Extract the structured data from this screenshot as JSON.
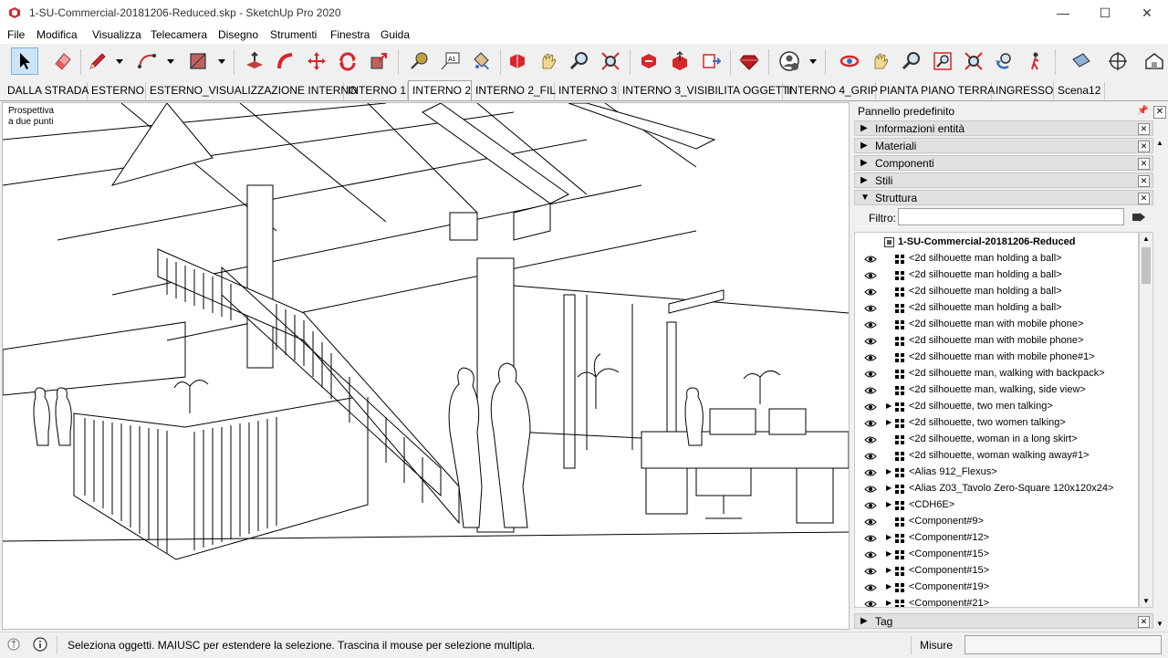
{
  "window": {
    "title": "1-SU-Commercial-20181206-Reduced.skp - SketchUp Pro 2020",
    "controls": [
      "—",
      "☐",
      "✕"
    ]
  },
  "menu": [
    "File",
    "Modifica",
    "Visualizza",
    "Telecamera",
    "Disegno",
    "Strumenti",
    "Finestra",
    "Guida"
  ],
  "toolbar": {
    "tools": [
      "select-tool",
      "eraser-tool",
      "line-tool",
      "arc-tool",
      "rectangle-tool",
      "push-pull-tool",
      "follow-me-tool",
      "move-tool",
      "rotate-tool",
      "scale-tool",
      "tape-measure-tool",
      "text-tool",
      "paint-bucket-tool",
      "components-tool",
      "warehouse-tool",
      "share-model-tool",
      "extension-warehouse-tool",
      "ruby-tool",
      "account-tool",
      "orbit-tool",
      "pan-tool",
      "zoom-tool",
      "zoom-window-tool",
      "zoom-extents-tool",
      "previous-view-tool",
      "walk-tool",
      "section-plane-tool",
      "position-camera-tool",
      "look-around-tool"
    ],
    "text_tool_label": "A1"
  },
  "scenes": {
    "tabs": [
      "DALLA STRADA",
      "ESTERNO",
      "ESTERNO_VISUALIZZAZIONE INTERNO",
      "INTERNO 1",
      "INTERNO 2",
      "INTERNO 2_FIL",
      "INTERNO 3",
      "INTERNO 3_VISIBILITA OGGETTI",
      "INTERNO 4_GRIP",
      "PIANTA PIANO TERRA",
      "INGRESSO",
      "Scena12"
    ],
    "active_index": 4
  },
  "viewport": {
    "perspective_label_line1": "Prospettiva",
    "perspective_label_line2": "a due punti"
  },
  "panel": {
    "title": "Pannello predefinito",
    "sections": [
      {
        "label": "Informazioni entità",
        "expanded": false
      },
      {
        "label": "Materiali",
        "expanded": false
      },
      {
        "label": "Componenti",
        "expanded": false
      },
      {
        "label": "Stili",
        "expanded": false
      },
      {
        "label": "Struttura",
        "expanded": true
      }
    ],
    "filter_label": "Filtro:",
    "filter_value": "",
    "outliner_root": "1-SU-Commercial-20181206-Reduced",
    "outliner_items": [
      {
        "label": "<2d silhouette man holding a ball>",
        "expandable": false
      },
      {
        "label": "<2d silhouette man holding a ball>",
        "expandable": false
      },
      {
        "label": "<2d silhouette man holding a ball>",
        "expandable": false
      },
      {
        "label": "<2d silhouette man holding a ball>",
        "expandable": false
      },
      {
        "label": "<2d silhouette man with mobile phone>",
        "expandable": false
      },
      {
        "label": "<2d silhouette man with mobile phone>",
        "expandable": false
      },
      {
        "label": "<2d silhouette man with mobile phone#1>",
        "expandable": false
      },
      {
        "label": "<2d silhouette man, walking with backpack>",
        "expandable": false
      },
      {
        "label": "<2d silhouette man, walking, side view>",
        "expandable": false
      },
      {
        "label": "<2d silhouette, two men talking>",
        "expandable": true
      },
      {
        "label": "<2d silhouette, two women talking>",
        "expandable": true
      },
      {
        "label": "<2d silhouette, woman in a long skirt>",
        "expandable": false
      },
      {
        "label": "<2d silhouette, woman walking away#1>",
        "expandable": false
      },
      {
        "label": "<Alias 912_Flexus>",
        "expandable": true
      },
      {
        "label": "<Alias Z03_Tavolo Zero-Square 120x120x24>",
        "expandable": true
      },
      {
        "label": "<CDH6E>",
        "expandable": true
      },
      {
        "label": "<Component#9>",
        "expandable": false
      },
      {
        "label": "<Component#12>",
        "expandable": true
      },
      {
        "label": "<Component#15>",
        "expandable": true
      },
      {
        "label": "<Component#15>",
        "expandable": true
      },
      {
        "label": "<Component#19>",
        "expandable": true
      },
      {
        "label": "<Component#21>",
        "expandable": true
      }
    ],
    "bottom_section": "Tag"
  },
  "status": {
    "text": "Seleziona oggetti. MAIUSC per estendere la selezione. Trascina il mouse per selezione multipla.",
    "measure_label": "Misure",
    "measure_value": ""
  },
  "colors": {
    "accent_selected": "#cde3f7",
    "sketchup_red": "#d7262c"
  }
}
